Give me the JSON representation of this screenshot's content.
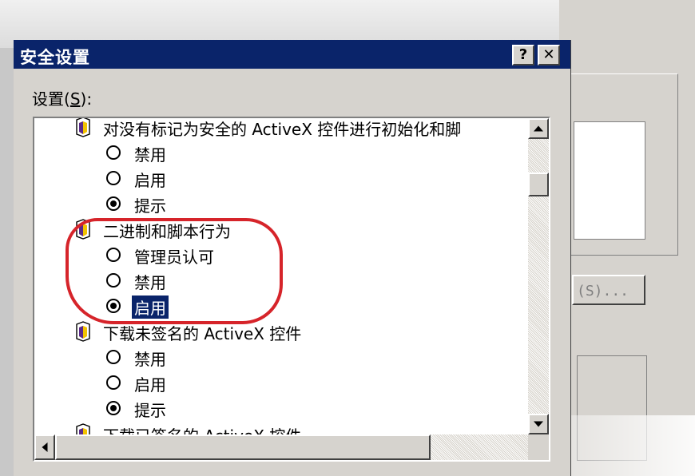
{
  "dialog": {
    "title": "安全设置",
    "help_label": "?",
    "close_label": "✕",
    "settings_label_prefix": "设置",
    "settings_label_key": "S",
    "settings_label_suffix": "):"
  },
  "background": {
    "button_label": "(S)..."
  },
  "settings": [
    {
      "category": "对没有标记为安全的 ActiveX 控件进行初始化和脚",
      "options": [
        {
          "label": "禁用",
          "checked": false
        },
        {
          "label": "启用",
          "checked": false
        },
        {
          "label": "提示",
          "checked": true
        }
      ]
    },
    {
      "category": "二进制和脚本行为",
      "options": [
        {
          "label": "管理员认可",
          "checked": false
        },
        {
          "label": "禁用",
          "checked": false
        },
        {
          "label": "启用",
          "checked": true,
          "selected": true
        }
      ]
    },
    {
      "category": "下载未签名的 ActiveX 控件",
      "options": [
        {
          "label": "禁用",
          "checked": false
        },
        {
          "label": "启用",
          "checked": false
        },
        {
          "label": "提示",
          "checked": true
        }
      ]
    },
    {
      "category": "下载已签名的 ActiveX 控件",
      "options": []
    }
  ],
  "colors": {
    "titlebar": "#0a246a",
    "highlight_circle": "#d6242a",
    "selection": "#0a246a"
  },
  "icons": {
    "category": "security-setting-icon",
    "scroll_up": "arrow-up-icon",
    "scroll_down": "arrow-down-icon",
    "scroll_left": "arrow-left-icon"
  }
}
